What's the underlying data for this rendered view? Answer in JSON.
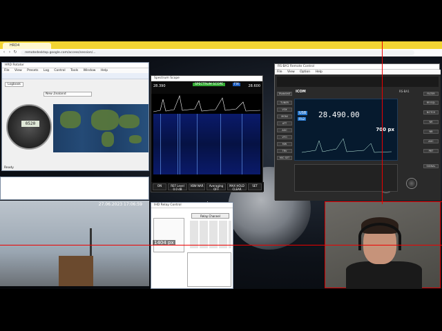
{
  "browser": {
    "tab_title": "HRD4",
    "url": "remotedesktop.google.com/access/session/..."
  },
  "rotator": {
    "title": "HRD Rotator",
    "menus": [
      "File",
      "View",
      "Presets",
      "Log",
      "Control",
      "Tools",
      "Window",
      "Help"
    ],
    "tab": "Logbook",
    "heading_readout": "0520",
    "country_label": "New Zealand",
    "status": "Ready"
  },
  "scope": {
    "title": "Spectrum Scope",
    "label": "SPECTRUM SCOPE",
    "fix": "FIX",
    "freq_left": "28.390",
    "freq_right": "28.600",
    "buttons": [
      {
        "label": "ON"
      },
      {
        "label": "REF Level 0.0 dB"
      },
      {
        "label": "VBW NAR"
      },
      {
        "label": "Averaging OFF"
      },
      {
        "label": "MAX HOLD CLEAR"
      },
      {
        "label": "SET"
      }
    ]
  },
  "radio": {
    "title": "RS-BA1 Remote Control",
    "menus": [
      "File",
      "View",
      "Option",
      "Help"
    ],
    "brand": "ICOM",
    "model": "RS-BA1",
    "frequency": "28.490.00",
    "mode": "USB",
    "filter": "FIL2",
    "px_readout": "700 px",
    "left_buttons": [
      "TRANSMIT",
      "TUNER",
      "VOX",
      "MONI",
      "ATT",
      "AGC",
      "VFO",
      "MW",
      "TRV",
      "MIC SET"
    ],
    "right_buttons": [
      "FILTER",
      "RF/SQL",
      "NOTCH",
      "NR",
      "NB",
      "AGC",
      "PBT",
      "SIGNAL"
    ]
  },
  "relay": {
    "title": "IHD Relay Control",
    "btn": "Relay Channel",
    "readout": "1404 px"
  },
  "webcam": {
    "timestamp": "27.06.2023 17:06:59"
  },
  "taskbar_label": "1404 px"
}
